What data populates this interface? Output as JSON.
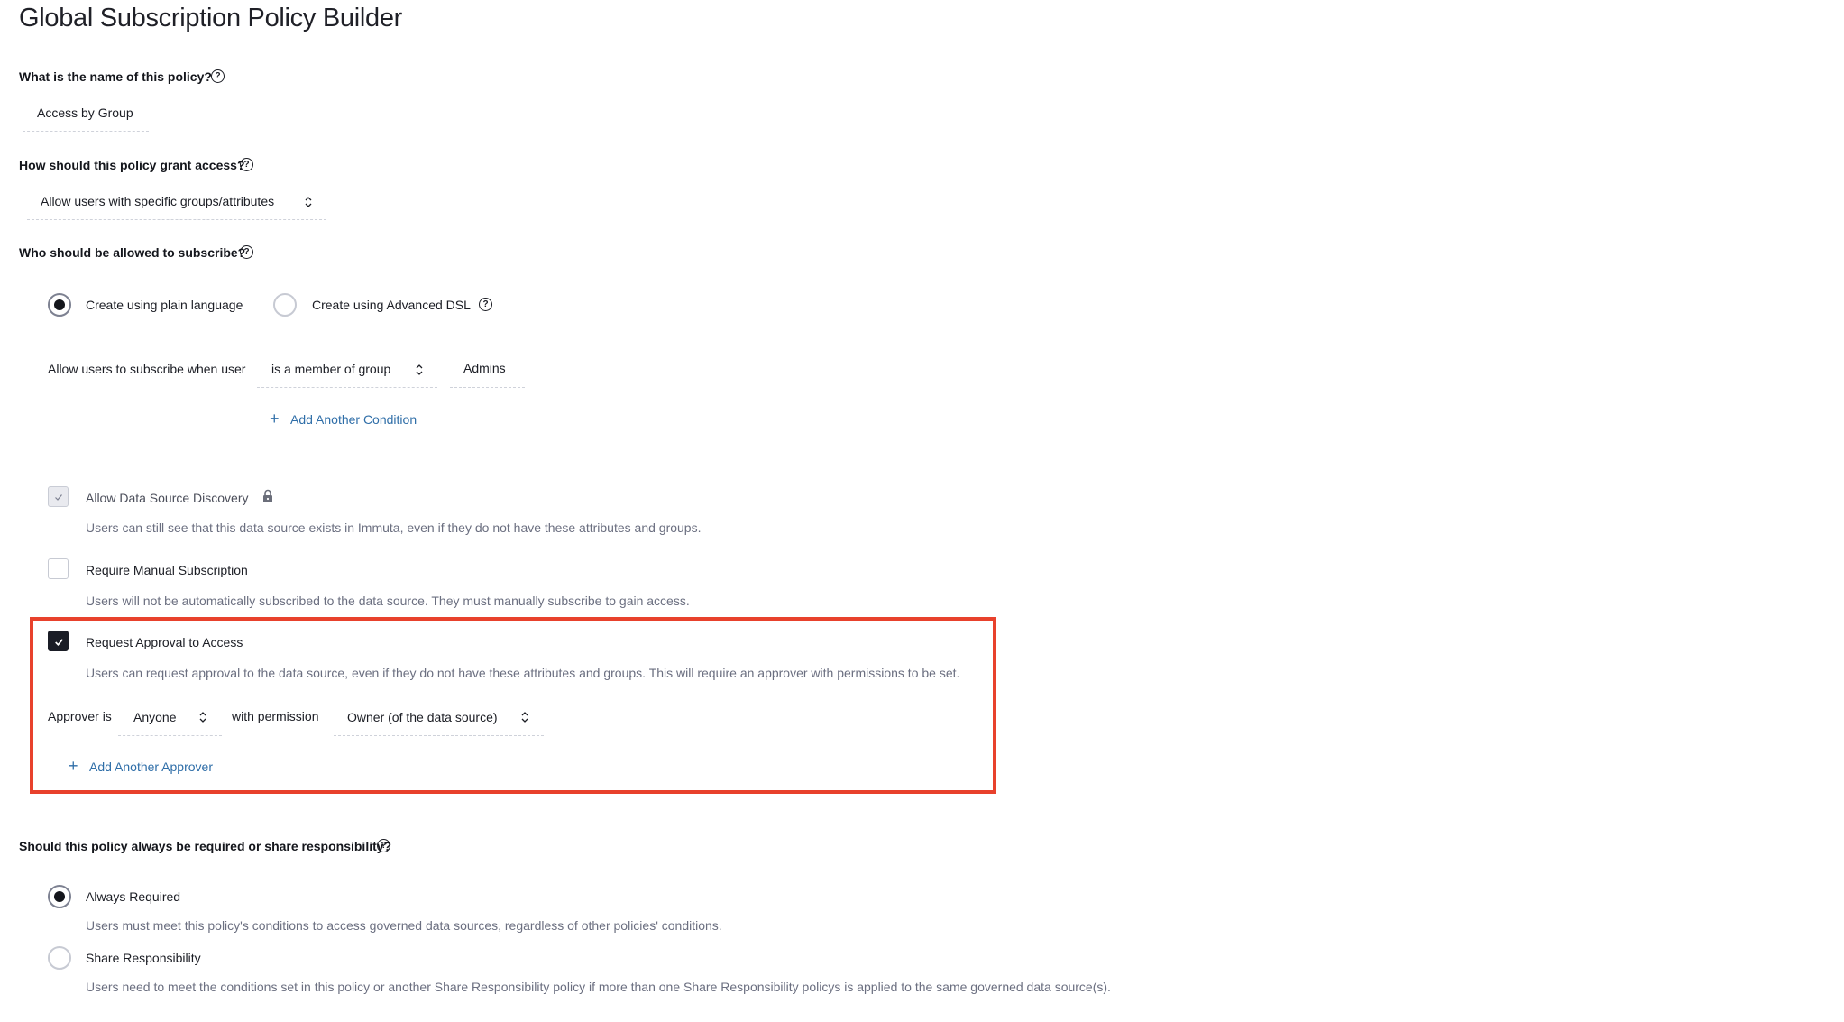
{
  "page": {
    "title": "Global Subscription Policy Builder"
  },
  "policy_name": {
    "question": "What is the name of this policy?",
    "help_icon": "help-circle-icon",
    "value": "Access by Group"
  },
  "grant_access": {
    "question": "How should this policy grant access?",
    "help_icon": "help-circle-icon",
    "selected": "Allow users with specific groups/attributes"
  },
  "subscribers": {
    "question": "Who should be allowed to subscribe?",
    "help_icon": "help-circle-icon",
    "modes": [
      {
        "label": "Create using plain language",
        "selected": true
      },
      {
        "label": "Create using Advanced DSL",
        "selected": false
      }
    ],
    "condition": {
      "prefix": "Allow users to subscribe when user",
      "operator": "is a member of group",
      "value": "Admins"
    },
    "add_condition_label": "Add Another Condition"
  },
  "options": [
    {
      "label": "Allow Data Source Discovery",
      "checked": true,
      "disabled": true,
      "locked": true,
      "description": "Users can still see that this data source exists in Immuta, even if they do not have these attributes and groups."
    },
    {
      "label": "Require Manual Subscription",
      "checked": false,
      "disabled": false,
      "description": "Users will not be automatically subscribed to the data source. They must manually subscribe to gain access."
    },
    {
      "label": "Request Approval to Access",
      "checked": true,
      "disabled": false,
      "highlighted": true,
      "description": "Users can request approval to the data source, even if they do not have these attributes and groups. This will require an approver with permissions to be set."
    }
  ],
  "approver": {
    "prefix": "Approver is",
    "approver_value": "Anyone",
    "middle": "with permission",
    "permission_value": "Owner (of the data source)",
    "add_approver_label": "Add Another Approver"
  },
  "responsibility": {
    "question": "Should this policy always be required or share responsibility?",
    "help_icon": "help-circle-icon",
    "choices": [
      {
        "label": "Always Required",
        "selected": true,
        "description": "Users must meet this policy's conditions to access governed data sources, regardless of other policies' conditions."
      },
      {
        "label": "Share Responsibility",
        "selected": false,
        "description": "Users need to meet the conditions set in this policy or another Share Responsibility policy if more than one Share Responsibility policys is applied to the same governed data source(s)."
      }
    ]
  },
  "colors": {
    "highlight_border": "#e8412c",
    "link": "#2f6ea8",
    "checkbox_checked": "#1a1d26",
    "description_text": "#6b6f80"
  }
}
